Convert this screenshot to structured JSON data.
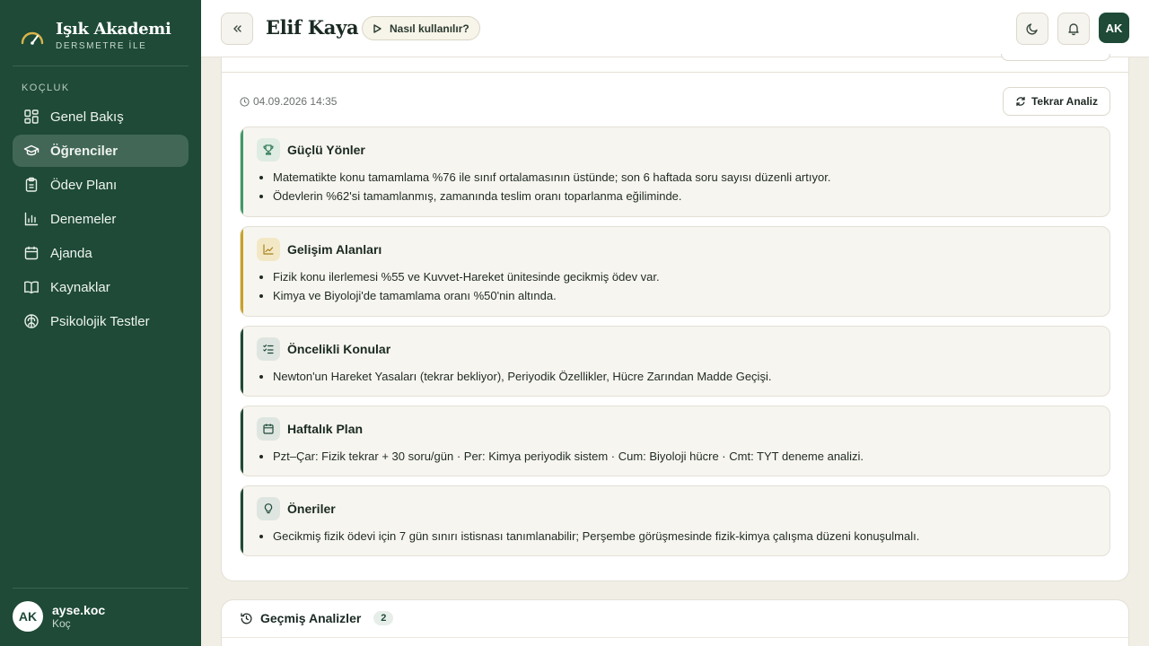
{
  "brand": {
    "name": "Işık Akademi",
    "subtitle": "DERSMETRE İLE"
  },
  "sidebar": {
    "section_label": "KOÇLUK",
    "items": [
      {
        "label": "Genel Bakış",
        "icon": "dashboard-icon",
        "active": false
      },
      {
        "label": "Öğrenciler",
        "icon": "graduation-cap-icon",
        "active": true
      },
      {
        "label": "Ödev Planı",
        "icon": "clipboard-icon",
        "active": false
      },
      {
        "label": "Denemeler",
        "icon": "bar-chart-icon",
        "active": false
      },
      {
        "label": "Ajanda",
        "icon": "calendar-icon",
        "active": false
      },
      {
        "label": "Kaynaklar",
        "icon": "book-icon",
        "active": false
      },
      {
        "label": "Psikolojik Testler",
        "icon": "brain-icon",
        "active": false
      }
    ],
    "user": {
      "initials": "AK",
      "name": "ayse.koc",
      "role": "Koç"
    }
  },
  "header": {
    "title": "Elif Kaya",
    "howto_label": "Nasıl kullanılır?",
    "avatar_initials": "AK"
  },
  "analysis": {
    "timestamp": "04.09.2026 14:35",
    "reanalyze_label": "Tekrar Analiz",
    "sections": [
      {
        "title": "Güçlü Yönler",
        "icon": "trophy-icon",
        "accent": "#3f9a6b",
        "items": [
          "Matematikte konu tamamlama %76 ile sınıf ortalamasının üstünde; son 6 haftada soru sayısı düzenli artıyor.",
          "Ödevlerin %62'si tamamlanmış, zamanında teslim oranı toparlanma eğiliminde."
        ]
      },
      {
        "title": "Gelişim Alanları",
        "icon": "trend-chart-icon",
        "accent": "#c9a227",
        "items": [
          "Fizik konu ilerlemesi %55 ve Kuvvet-Hareket ünitesinde gecikmiş ödev var.",
          "Kimya ve Biyoloji'de tamamlama oranı %50'nin altında."
        ]
      },
      {
        "title": "Öncelikli Konular",
        "icon": "checklist-icon",
        "accent": "#1e4a37",
        "items": [
          "Newton'un Hareket Yasaları (tekrar bekliyor), Periyodik Özellikler, Hücre Zarından Madde Geçişi."
        ]
      },
      {
        "title": "Haftalık Plan",
        "icon": "calendar-icon",
        "accent": "#1e4a37",
        "items": [
          "Pzt–Çar: Fizik tekrar + 30 soru/gün · Per: Kimya periyodik sistem · Cum: Biyoloji hücre · Cmt: TYT deneme analizi."
        ]
      },
      {
        "title": "Öneriler",
        "icon": "lightbulb-icon",
        "accent": "#1e4a37",
        "items": [
          "Gecikmiş fizik ödevi için 7 gün sınırı istisnası tanımlanabilir; Perşembe görüşmesinde fizik-kimya çalışma düzeni konuşulmalı."
        ]
      }
    ]
  },
  "history": {
    "title": "Geçmiş Analizler",
    "count": "2"
  }
}
